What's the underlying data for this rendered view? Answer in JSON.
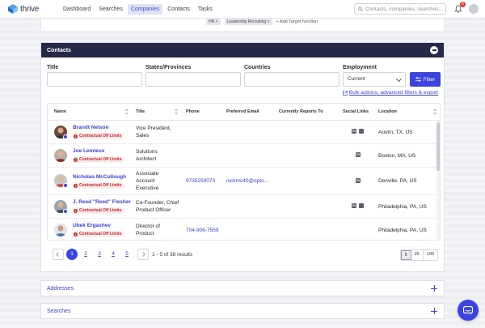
{
  "nav": {
    "logo_text": "thrive",
    "links": [
      "Dashboard",
      "Searches",
      "Companies",
      "Contacts",
      "Tasks"
    ],
    "active_index": 2,
    "search_placeholder": "Contacts, companies, searches...",
    "notification_count": "6"
  },
  "chips": {
    "items": [
      "HR",
      "Leadership Recruiting"
    ],
    "add_label": "+ Add Target function"
  },
  "contacts": {
    "title": "Contacts",
    "filters": {
      "title_label": "Title",
      "states_label": "States/Provinces",
      "countries_label": "Countries",
      "employment_label": "Employment",
      "employment_value": "Current",
      "filter_button": "Filter",
      "bulk_link": "Bulk actions, advanced filters & export"
    },
    "columns": [
      "Name",
      "Title",
      "Phone",
      "Preferred Email",
      "Currently Reports To",
      "Social Links",
      "Location"
    ],
    "badge_label": "Contractual Off Limits",
    "rows": [
      {
        "name": "Brandt Nelson",
        "title_lines": [
          "Vice President,",
          "Sales"
        ],
        "phone": "",
        "email": "",
        "reports_to": "",
        "socials": [
          "linkedin",
          "twitter"
        ],
        "location": "Austin, TX, US"
      },
      {
        "name": "Joe Lemieux",
        "title_lines": [
          "Solutions",
          "Architect"
        ],
        "phone": "",
        "email": "",
        "reports_to": "",
        "socials": [
          "linkedin"
        ],
        "location": "Boston, MA, US"
      },
      {
        "name": "Nicholas McCollough",
        "title_lines": [
          "Associate",
          "Account",
          "Executive"
        ],
        "phone": "9735259073",
        "email": "nickmc40@opto...",
        "reports_to": "",
        "socials": [
          "linkedin"
        ],
        "location": "Denville, PA, US"
      },
      {
        "name": "J. Reed \"Reed\" Flesher",
        "title_lines": [
          "Co-Founder, Chief",
          "Product Officer"
        ],
        "phone": "",
        "email": "",
        "reports_to": "",
        "socials": [
          "linkedin",
          "twitter"
        ],
        "location": "Philadelphia, PA, US"
      },
      {
        "name": "Ubek Ergashev",
        "title_lines": [
          "Director of",
          "Product"
        ],
        "phone": "704-906-7559",
        "email": "",
        "reports_to": "",
        "socials": [],
        "location": "Philadelphia, PA, US"
      }
    ],
    "pagination": {
      "pages": [
        "1",
        "2",
        "3",
        "4",
        "5"
      ],
      "current": "1",
      "results": "1 - 5 of 38 results",
      "page_sizes": [
        "5",
        "25",
        "100"
      ],
      "active_size": "5"
    }
  },
  "sections": {
    "addresses": "Addresses",
    "searches": "Searches"
  },
  "colors": {
    "primary": "#3b43e0",
    "header_dark": "#262a48",
    "danger": "#d32f2f"
  }
}
